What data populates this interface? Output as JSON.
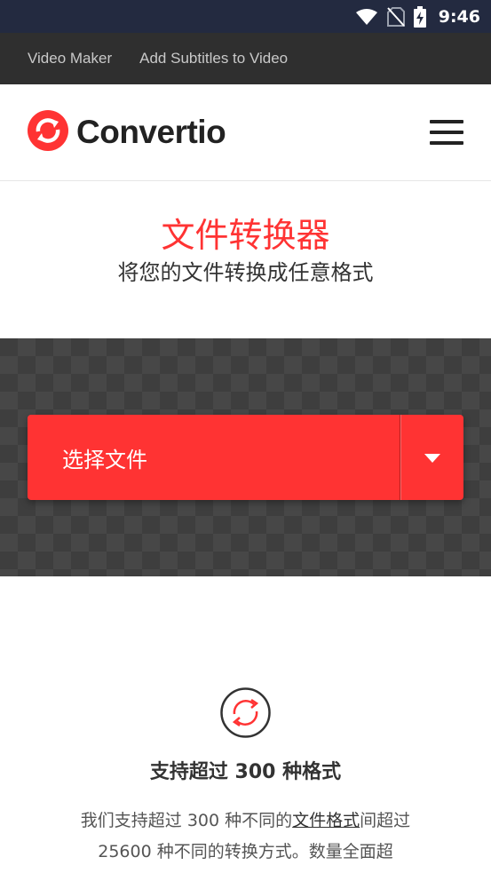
{
  "status_bar": {
    "time": "9:46",
    "icons": [
      "wifi-icon",
      "no-sim-icon",
      "battery-charging-icon"
    ]
  },
  "top_links": [
    {
      "label": "Video Maker"
    },
    {
      "label": "Add Subtitles to Video"
    }
  ],
  "header": {
    "logo_text": "Convertio",
    "menu_icon": "hamburger-menu-icon"
  },
  "hero": {
    "title": "文件转换器",
    "subtitle": "将您的文件转换成任意格式"
  },
  "upload": {
    "choose_file_label": "选择文件",
    "dropdown_icon": "caret-down-icon"
  },
  "feature": {
    "icon": "refresh-arrows-icon",
    "title": "支持超过 300 种格式",
    "desc_part1": "我们支持超过 300 种不同的",
    "desc_link": "文件格式",
    "desc_part2": "间超过 25600 种不同的转换方式。数量全面超"
  },
  "colors": {
    "brand_red": "#ff3333",
    "status_bar_bg": "#232a40",
    "top_links_bg": "#2f2f2f"
  }
}
